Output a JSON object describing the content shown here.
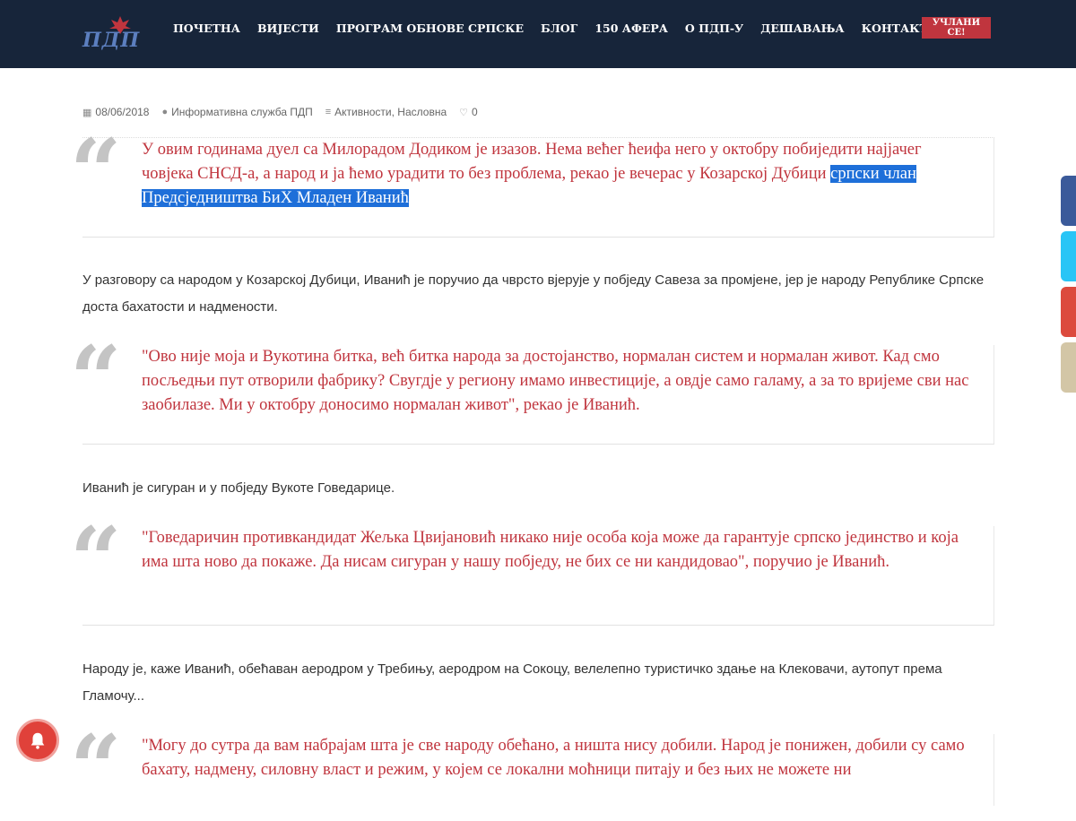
{
  "header": {
    "logo_text": "ПДП",
    "nav": [
      "ПОЧЕТНА",
      "ВИЈЕСТИ",
      "ПРОГРАМ ОБНОВЕ СРПСКЕ",
      "БЛОГ",
      "150 АФЕРА",
      "О ПДП-У",
      "ДЕШАВАЊА",
      "КОНТАКТ"
    ],
    "join_label": "УЧЛАНИ СЕ!"
  },
  "meta": {
    "date": "08/06/2018",
    "author": "Информативна служба ПДП",
    "categories": "Активности, Насловна",
    "likes": "0",
    "icons": [
      "calendar-icon",
      "user-icon",
      "list-icon",
      "heart-icon"
    ]
  },
  "article": {
    "quote1_plain": "У овим годинама дуел са Милорадом Додиком је изазов. Нема већег ћеифа него у октобру побиједити најјачег човјека СНСД-а, а народ и ја ћемо урадити то без проблема, рекао је вечерас у Козарској Дубици ",
    "quote1_highlight": "српски члан Предсједништва БиХ Младен Иванић",
    "para1": "У разговору са народом у Козарској Дубици, Иванић је поручио да чврсто вјерује у побједу Савеза за промјене, јер је народу Републике Српске доста бахатости и надмености.",
    "quote2": "\"Ово није моја и Вукотина битка, већ битка народа за достојанство, нормалан систем и нормалан живот. Кад смо посљедњи пут отворили фабрику? Свугдје у региону имамо инвестиције, а овдје само галаму, а за то вријеме сви нас заобилазе. Ми у октобру доносимо нормалан живот\", рекао је Иванић.",
    "para2": "Иванић је сигуран и у побједу Вукоте Говедарице.",
    "quote3": "\"Говедаричин противкандидат Жељка Цвијановић никако није особа која може да гарантује српско јединство и која има шта ново да покаже. Да нисам сигуран у нашу побједу, не бих се ни кандидовао\", поручио је Иванић.",
    "para3": "Народу је, каже Иванић, обећаван аеродром у Требињу, аеродром на Сокоцу, велелепно туристичко здање на Клековачи, аутопут према Гламочу...",
    "quote4": "\"Могу до сутра да вам набрајам шта је све народу обећано, а ништа нису добили. Народ је понижен, добили су само бахату, надмену, силовну власт и режим, у којем се локални моћници питају и без њих не можете ни",
    "quote_mark": "“"
  },
  "colors": {
    "header_bg": "#17253a",
    "accent_red": "#c0353e",
    "highlight": "#1e6fd9"
  }
}
